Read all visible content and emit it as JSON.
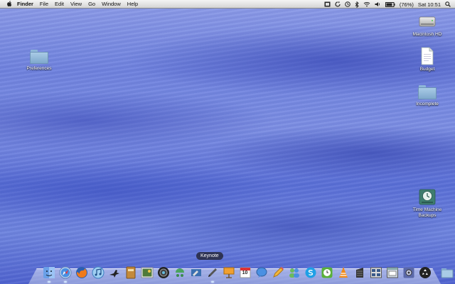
{
  "menubar": {
    "app_name": "Finder",
    "menus": [
      "File",
      "Edit",
      "View",
      "Go",
      "Window",
      "Help"
    ],
    "battery": "(76%)",
    "clock": "Sat 10:51"
  },
  "desktop_icons": {
    "preferences": "Preferences",
    "macintosh_hd": "Macintosh HD",
    "budget": "Budget",
    "incomplete": "Incomplete",
    "time_machine_line1": "Time Machine",
    "time_machine_line2": "Backups"
  },
  "dock": {
    "tooltip": "Keynote",
    "calendar_day": "10",
    "items": [
      "finder",
      "safari",
      "firefox",
      "itunes",
      "bird",
      "notebook",
      "photo",
      "aperture",
      "dashboard",
      "brush",
      "pen",
      "keynote",
      "calendar",
      "ichat",
      "pencil",
      "people",
      "skype",
      "clock",
      "vlc",
      "film",
      "grid",
      "window",
      "settings",
      "recycle",
      "folder"
    ]
  },
  "colors": {
    "wallpaper_base": "#6f82de",
    "menubar_bg": "#e6e6e6",
    "tooltip_bg": "#222230"
  }
}
